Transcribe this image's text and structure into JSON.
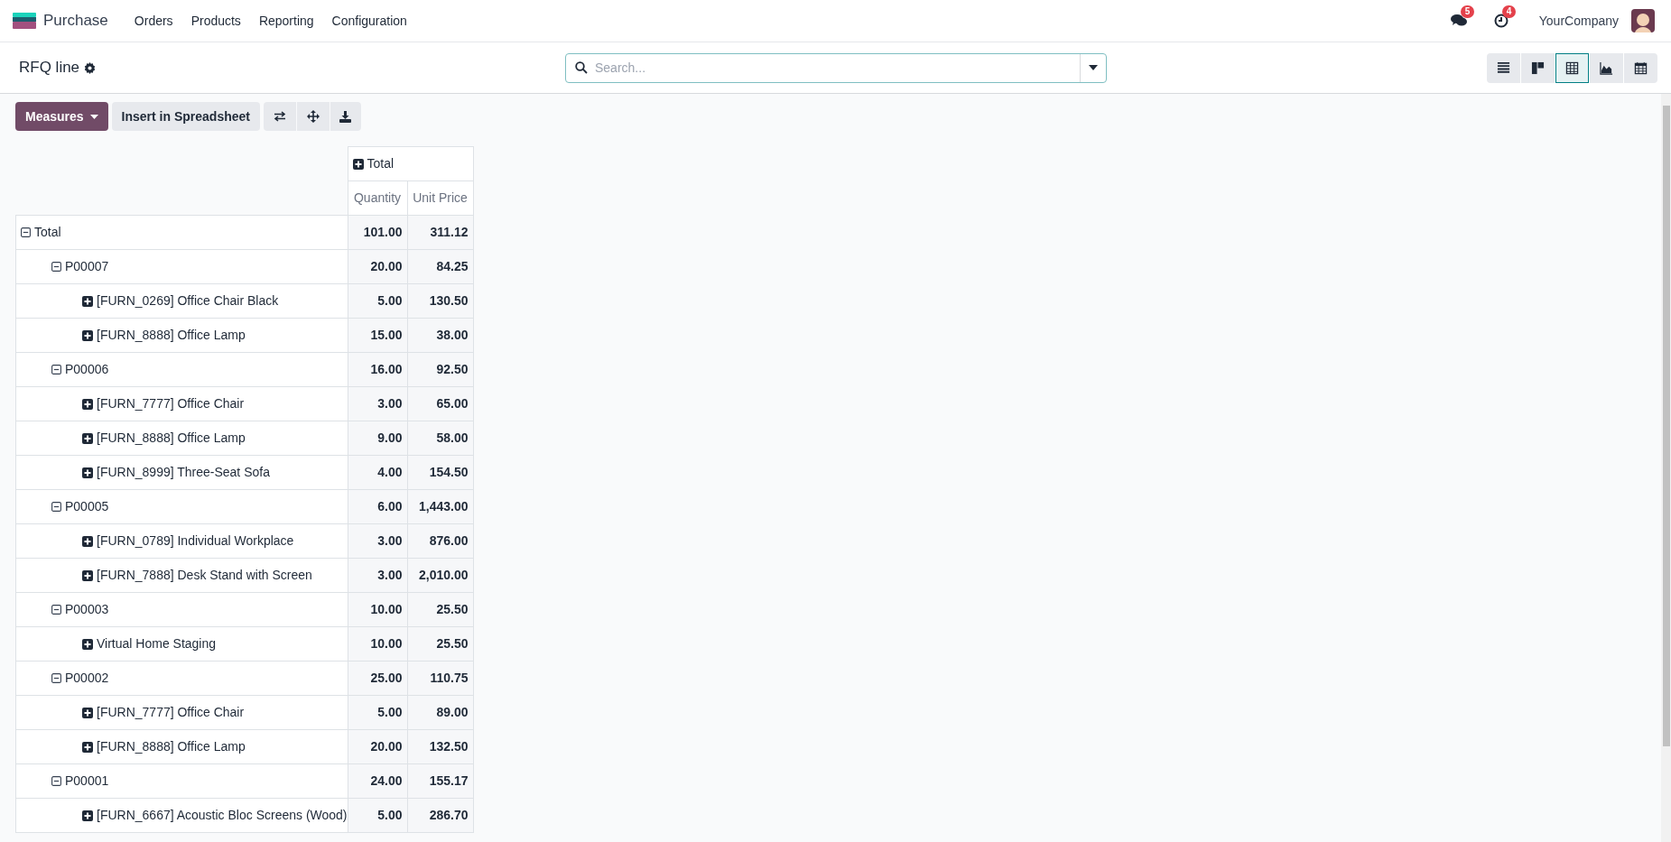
{
  "navbar": {
    "app_name": "Purchase",
    "menu": [
      "Orders",
      "Products",
      "Reporting",
      "Configuration"
    ],
    "messages_badge": "5",
    "activities_badge": "4",
    "company": "YourCompany"
  },
  "control_panel": {
    "title": "RFQ line",
    "search": {
      "placeholder": "Search..."
    },
    "views": [
      {
        "kind": "list",
        "selected": false
      },
      {
        "kind": "kanban",
        "selected": false
      },
      {
        "kind": "pivot",
        "selected": true
      },
      {
        "kind": "graph",
        "selected": false
      },
      {
        "kind": "calendar",
        "selected": false
      }
    ]
  },
  "toolbar": {
    "measures": "Measures",
    "insert": "Insert in Spreadsheet"
  },
  "pivot": {
    "column_header": {
      "label": "Total",
      "expanded": false
    },
    "measures": [
      "Quantity",
      "Unit Price"
    ],
    "rows": [
      {
        "label": "Total",
        "expanded": true,
        "values": [
          "101.00",
          "311.12"
        ],
        "children": [
          {
            "label": "P00007",
            "expanded": true,
            "values": [
              "20.00",
              "84.25"
            ],
            "children": [
              {
                "label": "[FURN_0269] Office Chair Black",
                "expanded": false,
                "values": [
                  "5.00",
                  "130.50"
                ]
              },
              {
                "label": "[FURN_8888] Office Lamp",
                "expanded": false,
                "values": [
                  "15.00",
                  "38.00"
                ]
              }
            ]
          },
          {
            "label": "P00006",
            "expanded": true,
            "values": [
              "16.00",
              "92.50"
            ],
            "children": [
              {
                "label": "[FURN_7777] Office Chair",
                "expanded": false,
                "values": [
                  "3.00",
                  "65.00"
                ]
              },
              {
                "label": "[FURN_8888] Office Lamp",
                "expanded": false,
                "values": [
                  "9.00",
                  "58.00"
                ]
              },
              {
                "label": "[FURN_8999] Three-Seat Sofa",
                "expanded": false,
                "values": [
                  "4.00",
                  "154.50"
                ]
              }
            ]
          },
          {
            "label": "P00005",
            "expanded": true,
            "values": [
              "6.00",
              "1,443.00"
            ],
            "children": [
              {
                "label": "[FURN_0789] Individual Workplace",
                "expanded": false,
                "values": [
                  "3.00",
                  "876.00"
                ]
              },
              {
                "label": "[FURN_7888] Desk Stand with Screen",
                "expanded": false,
                "values": [
                  "3.00",
                  "2,010.00"
                ]
              }
            ]
          },
          {
            "label": "P00003",
            "expanded": true,
            "values": [
              "10.00",
              "25.50"
            ],
            "children": [
              {
                "label": "Virtual Home Staging",
                "expanded": false,
                "values": [
                  "10.00",
                  "25.50"
                ]
              }
            ]
          },
          {
            "label": "P00002",
            "expanded": true,
            "values": [
              "25.00",
              "110.75"
            ],
            "children": [
              {
                "label": "[FURN_7777] Office Chair",
                "expanded": false,
                "values": [
                  "5.00",
                  "89.00"
                ]
              },
              {
                "label": "[FURN_8888] Office Lamp",
                "expanded": false,
                "values": [
                  "20.00",
                  "132.50"
                ]
              }
            ]
          },
          {
            "label": "P00001",
            "expanded": true,
            "values": [
              "24.00",
              "155.17"
            ],
            "children": [
              {
                "label": "[FURN_6667] Acoustic Bloc Screens (Wood)",
                "expanded": false,
                "values": [
                  "5.00",
                  "286.70"
                ]
              }
            ]
          }
        ]
      }
    ]
  }
}
